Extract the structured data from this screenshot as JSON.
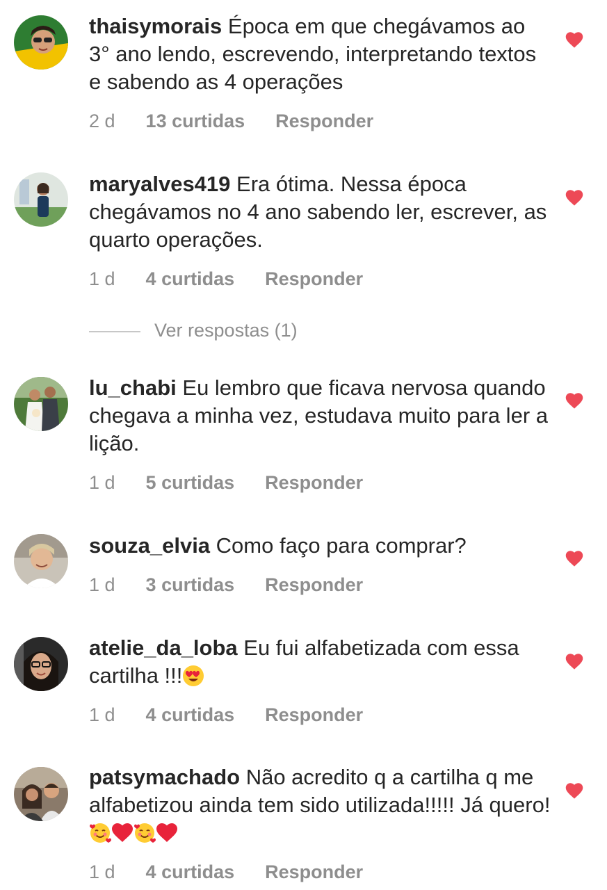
{
  "colors": {
    "text": "#262626",
    "meta": "#8e8e8e",
    "heart": "#ed4956",
    "divider": "#c7c7c7"
  },
  "comments": [
    {
      "username": "thaisymorais",
      "text": "Época em que chegávamos ao 3° ano lendo, escrevendo, interpretando textos e sabendo as 4 operações",
      "time": "2 d",
      "likes": "13 curtidas",
      "reply": "Responder",
      "liked": true,
      "emoji": []
    },
    {
      "username": "maryalves419",
      "text": "Era ótima. Nessa época chegávamos no 4 ano sabendo ler, escrever, as quarto operações.",
      "time": "1 d",
      "likes": "4 curtidas",
      "reply": "Responder",
      "liked": true,
      "emoji": []
    },
    {
      "username": "lu_chabi",
      "text": "Eu lembro que ficava nervosa quando chegava a minha vez, estudava muito para ler a lição.",
      "time": "1 d",
      "likes": "5 curtidas",
      "reply": "Responder",
      "liked": true,
      "emoji": []
    },
    {
      "username": "souza_elvia",
      "text": "Como faço para comprar?",
      "time": "1 d",
      "likes": "3 curtidas",
      "reply": "Responder",
      "liked": true,
      "emoji": []
    },
    {
      "username": "atelie_da_loba",
      "text": "Eu fui alfabetizada com essa cartilha !!!",
      "time": "1 d",
      "likes": "4 curtidas",
      "reply": "Responder",
      "liked": true,
      "emoji": [
        "heart-eyes-emoji"
      ]
    },
    {
      "username": "patsymachado",
      "text": "Não acredito q a cartilha q me alfabetizou ainda tem sido utilizada!!!!! Já quero!",
      "time": "1 d",
      "likes": "4 curtidas",
      "reply": "Responder",
      "liked": true,
      "emoji": [
        "smiling-face-with-hearts-emoji",
        "red-heart-emoji",
        "smiling-face-with-hearts-emoji",
        "red-heart-emoji"
      ]
    }
  ],
  "view_replies": "Ver respostas (1)"
}
